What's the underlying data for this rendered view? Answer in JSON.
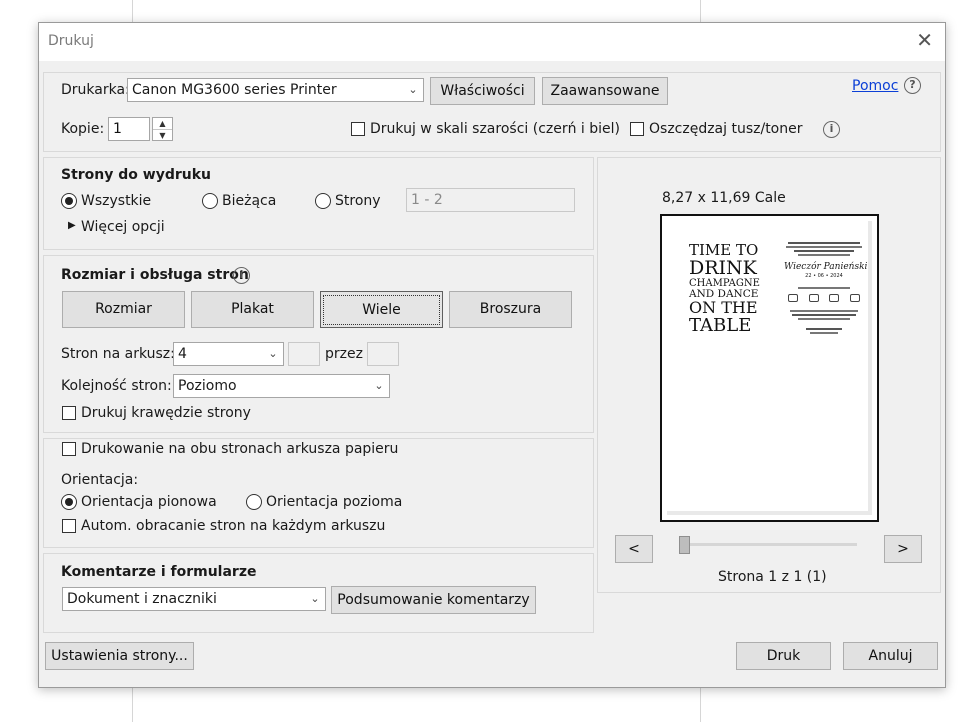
{
  "dialog": {
    "title": "Drukuj"
  },
  "printer": {
    "label": "Drukarka:",
    "selected": "Canon MG3600 series Printer",
    "properties_button": "Właściwości",
    "advanced_button": "Zaawansowane",
    "help_link": "Pomoc"
  },
  "copies": {
    "label": "Kopie:",
    "value": "1",
    "grayscale_label": "Drukuj w skali szarości (czerń i biel)",
    "save_ink_label": "Oszczędzaj tusz/toner"
  },
  "pages": {
    "heading": "Strony do wydruku",
    "all": "Wszystkie",
    "current": "Bieżąca",
    "pages": "Strony",
    "range_placeholder": "1 - 2",
    "more_options": "Więcej opcji",
    "selected": "all"
  },
  "sizing": {
    "heading": "Rozmiar i obsługa stron",
    "buttons": [
      "Rozmiar",
      "Plakat",
      "Wiele",
      "Broszura"
    ],
    "selected": "Wiele",
    "pages_per_sheet_label": "Stron na arkusz:",
    "pages_per_sheet_value": "4",
    "by_label": "przez",
    "order_label": "Kolejność stron:",
    "order_value": "Poziomo",
    "print_borders_label": "Drukuj krawędzie strony"
  },
  "duplex": {
    "both_sides_label": "Drukowanie na obu stronach arkusza papieru",
    "orientation_label": "Orientacja:",
    "portrait": "Orientacja pionowa",
    "landscape": "Orientacja pozioma",
    "auto_rotate": "Autom. obracanie stron na każdym arkuszu",
    "selected": "portrait"
  },
  "comments": {
    "heading": "Komentarze i formularze",
    "selected": "Dokument i znaczniki",
    "summary_button": "Podsumowanie komentarzy"
  },
  "preview": {
    "paper_size": "8,27 x 11,69 Cale",
    "page_info": "Strona 1 z 1 (1)",
    "prev": "<",
    "next": ">",
    "page1_lines": [
      "TIME TO",
      "DRINK",
      "CHAMPAGNE",
      "AND DANCE",
      "ON THE",
      "TABLE"
    ],
    "page2_title": "Wieczór Panieński",
    "page2_date": "22 • 06 • 2024"
  },
  "footer": {
    "page_setup": "Ustawienia strony...",
    "print": "Druk",
    "cancel": "Anuluj"
  }
}
